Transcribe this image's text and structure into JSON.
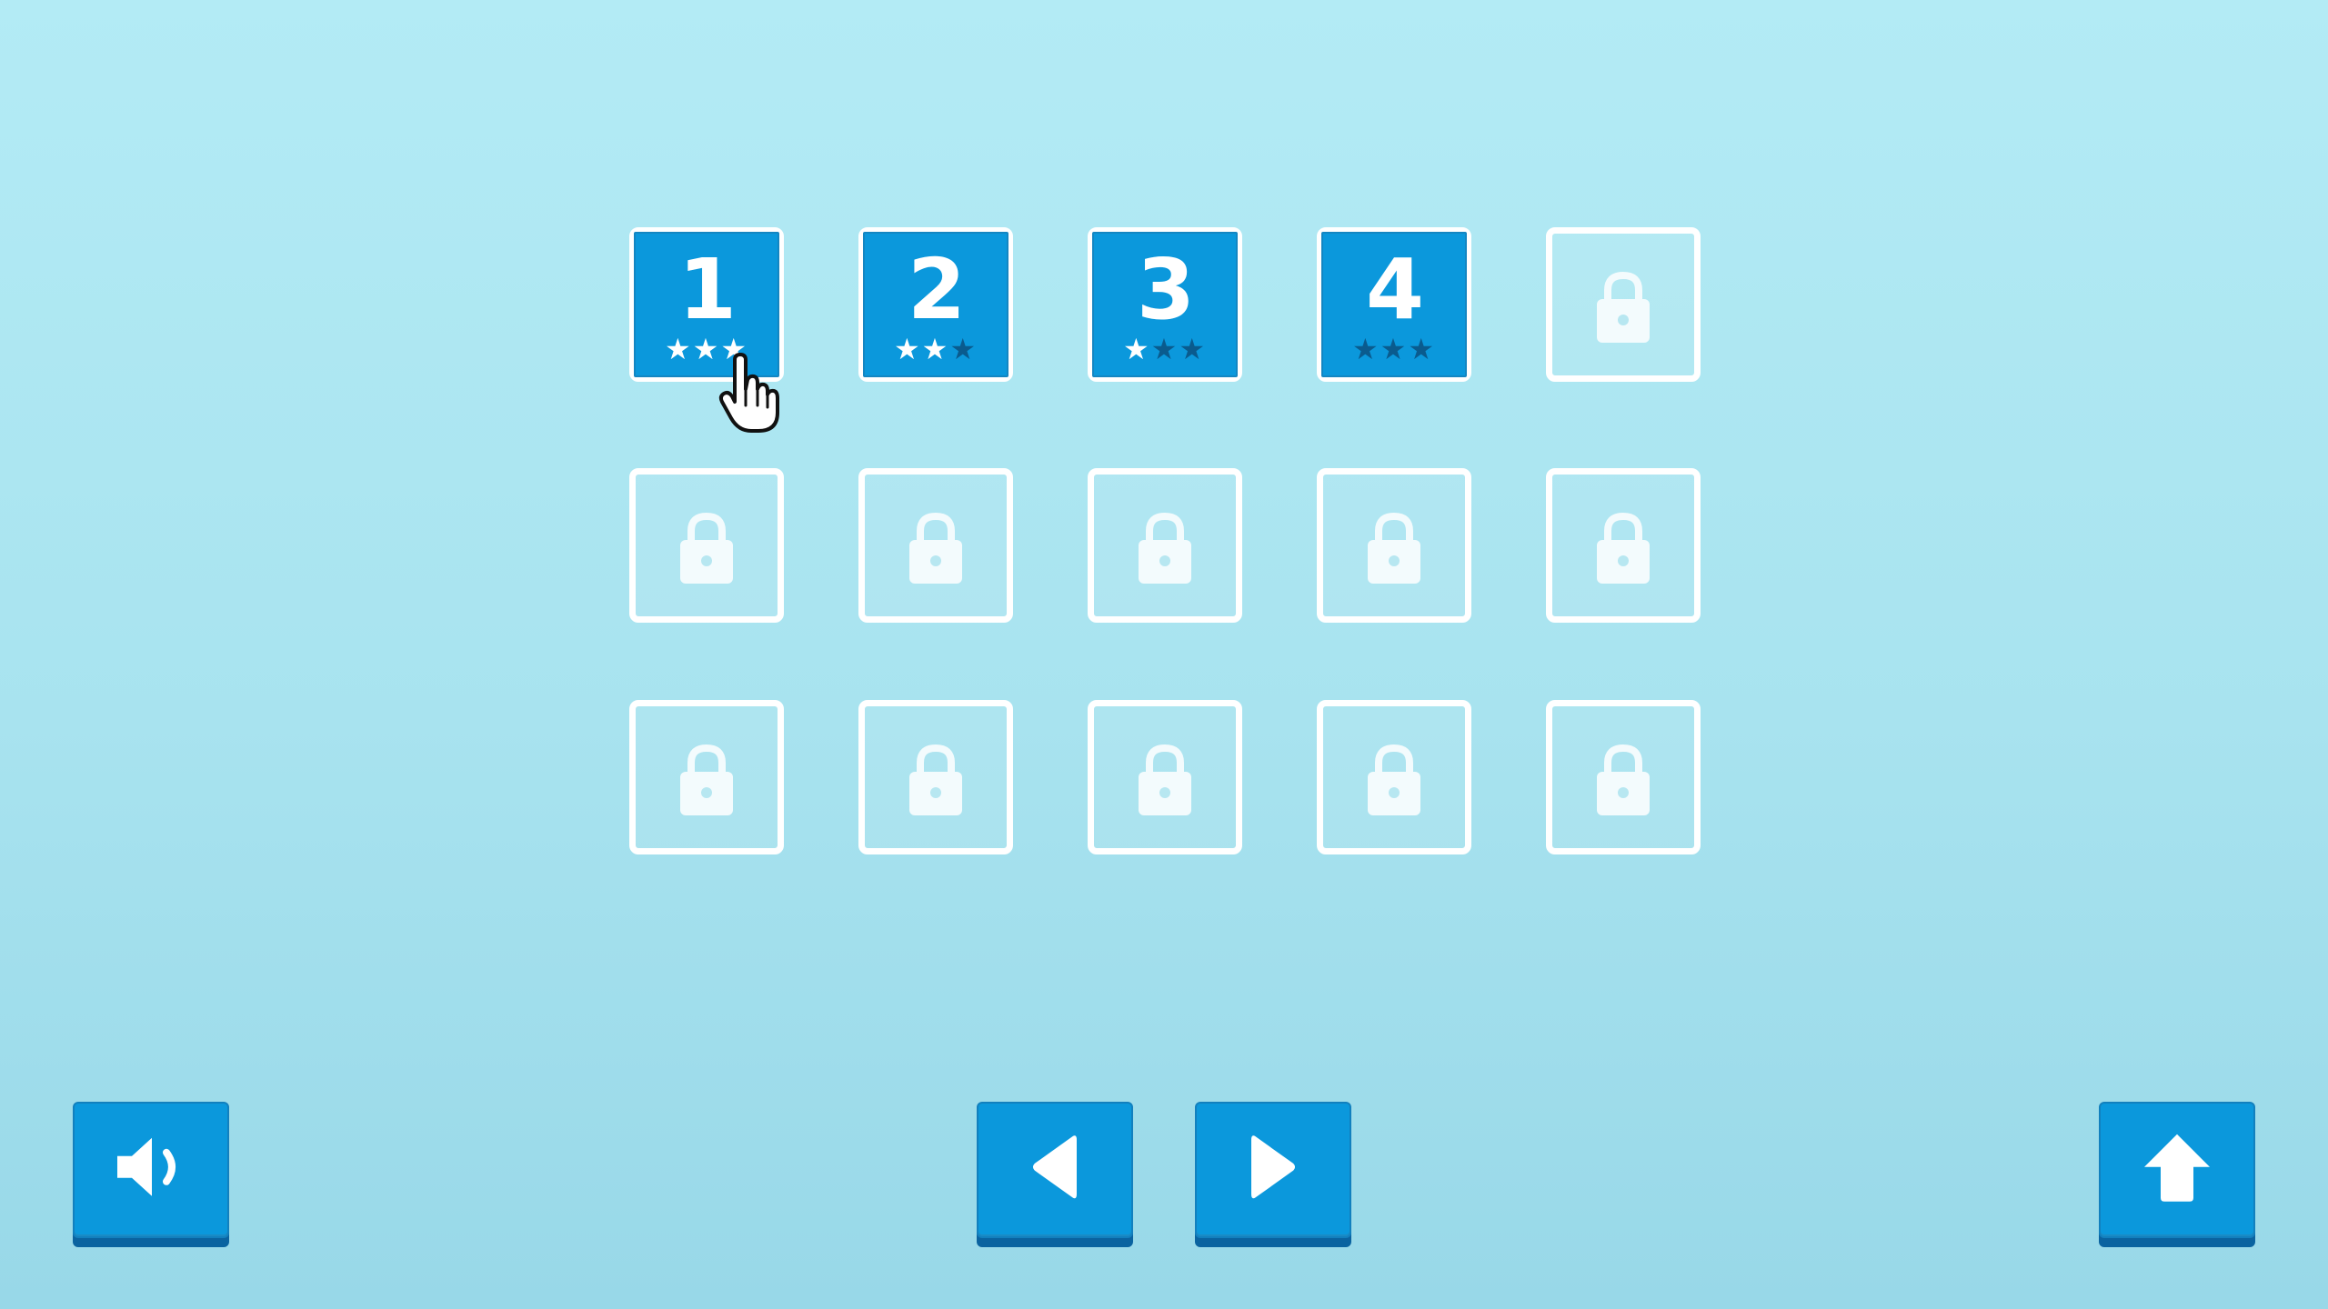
{
  "levels": [
    {
      "label": "1",
      "locked": false,
      "stars": 3
    },
    {
      "label": "2",
      "locked": false,
      "stars": 2
    },
    {
      "label": "3",
      "locked": false,
      "stars": 1
    },
    {
      "label": "4",
      "locked": false,
      "stars": 0
    },
    {
      "label": "",
      "locked": true,
      "stars": 0
    },
    {
      "label": "",
      "locked": true,
      "stars": 0
    },
    {
      "label": "",
      "locked": true,
      "stars": 0
    },
    {
      "label": "",
      "locked": true,
      "stars": 0
    },
    {
      "label": "",
      "locked": true,
      "stars": 0
    },
    {
      "label": "",
      "locked": true,
      "stars": 0
    },
    {
      "label": "",
      "locked": true,
      "stars": 0
    },
    {
      "label": "",
      "locked": true,
      "stars": 0
    },
    {
      "label": "",
      "locked": true,
      "stars": 0
    },
    {
      "label": "",
      "locked": true,
      "stars": 0
    },
    {
      "label": "",
      "locked": true,
      "stars": 0
    }
  ],
  "max_stars": 3,
  "buttons": {
    "sound": {
      "icon": "speaker-icon"
    },
    "prev": {
      "icon": "arrow-left-icon"
    },
    "next": {
      "icon": "arrow-right-icon"
    },
    "home": {
      "icon": "home-arrow-up-icon"
    }
  },
  "colors": {
    "background_top": "#b3ebf5",
    "background_bottom": "#98d8e8",
    "tile_blue": "#0b98dc",
    "star_empty": "#0a5b8e",
    "white": "#ffffff"
  }
}
